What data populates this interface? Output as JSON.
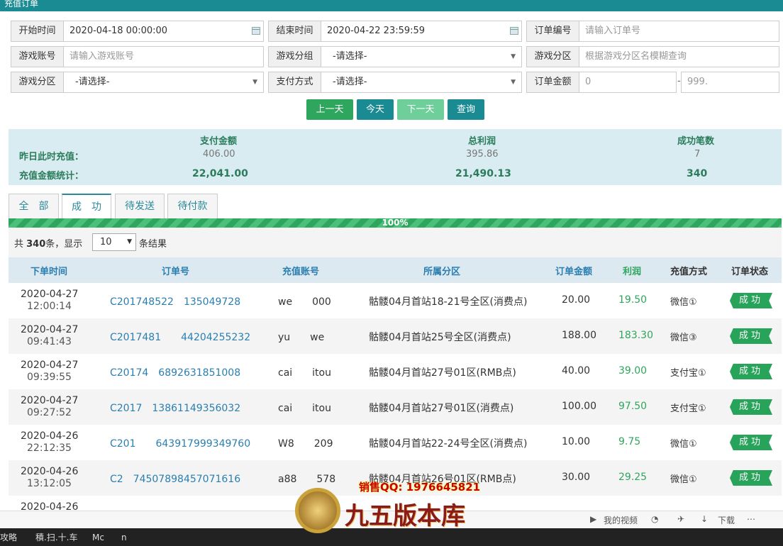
{
  "filters": {
    "start_time": {
      "label": "开始时间",
      "value": "2020-04-18 00:00:00"
    },
    "end_time": {
      "label": "结束时间",
      "value": "2020-04-22 23:59:59"
    },
    "order_no": {
      "label": "订单编号",
      "placeholder": "请输入订单号"
    },
    "game_account": {
      "label": "游戏账号",
      "placeholder": "请输入游戏账号"
    },
    "game_group": {
      "label": "游戏分组",
      "value": "-请选择-"
    },
    "game_zone_search": {
      "label": "游戏分区",
      "placeholder": "根据游戏分区名模糊查询"
    },
    "game_zone": {
      "label": "游戏分区",
      "value": "-请选择-"
    },
    "pay_method": {
      "label": "支付方式",
      "value": "-请选择-"
    },
    "amount": {
      "label": "订单金额",
      "min": "0",
      "sep": "-",
      "max": "999."
    }
  },
  "buttons": {
    "prev_day": "上一天",
    "today": "今天",
    "next_day": "下一天",
    "query": "查询"
  },
  "stats": {
    "headers": [
      "支付金额",
      "总利润",
      "成功笔数"
    ],
    "row1_label": "昨日此时充值：",
    "row1": [
      "406.00",
      "395.86",
      "7"
    ],
    "row2_label": "充值金额统计：",
    "row2": [
      "22,041.00",
      "21,490.13",
      "340"
    ]
  },
  "tabs": [
    "全　部",
    "成　功",
    "待发送",
    "待付款"
  ],
  "progress": {
    "label": "100%",
    "value": 1.0
  },
  "summary": {
    "prefix": "共 ",
    "count": "340",
    "mid": "条，显示",
    "page_size": "10",
    "suffix": "条结果"
  },
  "columns": [
    "下单时间",
    "订单号",
    "充值账号",
    "所属分区",
    "订单金额",
    "利润",
    "充值方式",
    "订单状态"
  ],
  "rows": [
    {
      "date": "2020-04-27",
      "time": "12:00:14",
      "order": "C201748522　135049728",
      "account": "we　　000",
      "zone": "骷髅04月首站18-21号全区(消费点)",
      "amount": "20.00",
      "profit": "19.50",
      "pay": "微信①",
      "status": "成功"
    },
    {
      "date": "2020-04-27",
      "time": "09:41:43",
      "order": "C2017481　　44204255232",
      "account": "yu　　we",
      "zone": "骷髅04月首站25号全区(消费点)",
      "amount": "188.00",
      "profit": "183.30",
      "pay": "微信③",
      "status": "成功"
    },
    {
      "date": "2020-04-27",
      "time": "09:39:55",
      "order": "C20174　6892631851008",
      "account": "cai　　itou",
      "zone": "骷髅04月首站27号01区(RMB点)",
      "amount": "40.00",
      "profit": "39.00",
      "pay": "支付宝①",
      "status": "成功"
    },
    {
      "date": "2020-04-27",
      "time": "09:27:52",
      "order": "C2017　13861149356032",
      "account": "cai　　itou",
      "zone": "骷髅04月首站27号01区(消费点)",
      "amount": "100.00",
      "profit": "97.50",
      "pay": "支付宝①",
      "status": "成功"
    },
    {
      "date": "2020-04-26",
      "time": "22:12:35",
      "order": "C201　　643917999349760",
      "account": "W8　　209",
      "zone": "骷髅04月首站22-24号全区(消费点)",
      "amount": "10.00",
      "profit": "9.75",
      "pay": "微信①",
      "status": "成功"
    },
    {
      "date": "2020-04-26",
      "time": "13:12:05",
      "order": "C2　74507898457071616",
      "account": "a88　　578",
      "zone": "骷髅04月首站26号01区(RMB点)",
      "amount": "30.00",
      "profit": "29.25",
      "pay": "微信①",
      "status": "成功"
    },
    {
      "date": "2020-04-26",
      "time": "",
      "order": "",
      "account": "",
      "zone": "",
      "amount": "",
      "profit": "",
      "pay": "",
      "status": ""
    }
  ],
  "bottom_bar": {
    "my_video": "我的视频",
    "download": "下载"
  },
  "taskbar": [
    "攻略",
    "積.扫.十.车",
    "Mc　　n"
  ],
  "ad": {
    "text": "销售QQ: 1976645821",
    "brand": "九五版本库"
  },
  "colors": {
    "teal": "#1a8a93",
    "green": "#27a35a",
    "link_blue": "#2a7fb0"
  }
}
